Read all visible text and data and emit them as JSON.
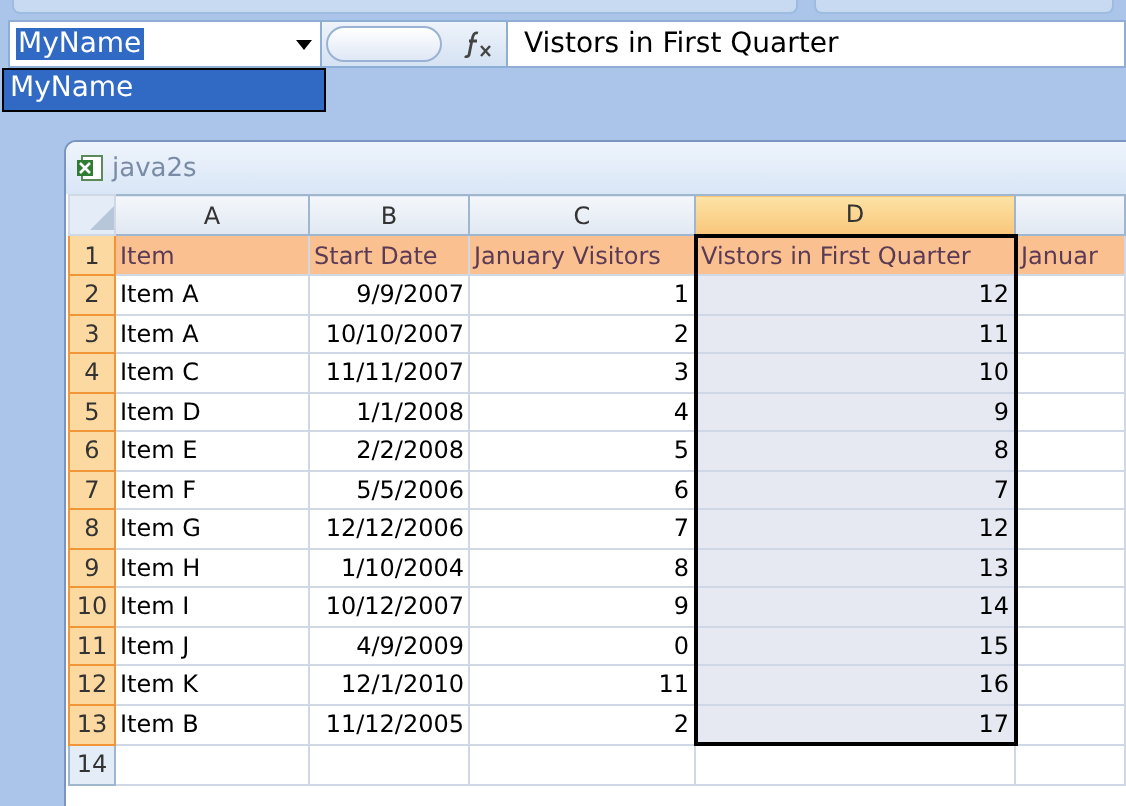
{
  "name_box": {
    "value": "MyName",
    "text_selected": true
  },
  "formula_bar": {
    "value": "Vistors in First Quarter"
  },
  "name_dropdown": {
    "items": [
      {
        "label": "MyName",
        "selected": true
      }
    ]
  },
  "workbook": {
    "title": "java2s",
    "columns": [
      {
        "letter": "A",
        "selected": false,
        "numeric": false
      },
      {
        "letter": "B",
        "selected": false,
        "numeric": true
      },
      {
        "letter": "C",
        "selected": false,
        "numeric": true
      },
      {
        "letter": "D",
        "selected": true,
        "numeric": true
      },
      {
        "selected": false
      }
    ],
    "rows": [
      {
        "number": "1",
        "selected": true,
        "kind": "header",
        "cells": [
          "Item",
          "Start Date",
          "January Visitors",
          "Vistors in First Quarter",
          "Januar"
        ]
      },
      {
        "number": "2",
        "selected": true,
        "kind": "data",
        "cells": [
          "Item A",
          "9/9/2007",
          "1",
          "12"
        ]
      },
      {
        "number": "3",
        "selected": true,
        "kind": "data",
        "cells": [
          "Item A",
          "10/10/2007",
          "2",
          "11"
        ]
      },
      {
        "number": "4",
        "selected": true,
        "kind": "data",
        "cells": [
          "Item C",
          "11/11/2007",
          "3",
          "10"
        ]
      },
      {
        "number": "5",
        "selected": true,
        "kind": "data",
        "cells": [
          "Item D",
          "1/1/2008",
          "4",
          "9"
        ]
      },
      {
        "number": "6",
        "selected": true,
        "kind": "data",
        "cells": [
          "Item E",
          "2/2/2008",
          "5",
          "8"
        ]
      },
      {
        "number": "7",
        "selected": true,
        "kind": "data",
        "cells": [
          "Item F",
          "5/5/2006",
          "6",
          "7"
        ]
      },
      {
        "number": "8",
        "selected": true,
        "kind": "data",
        "cells": [
          "Item G",
          "12/12/2006",
          "7",
          "12"
        ]
      },
      {
        "number": "9",
        "selected": true,
        "kind": "data",
        "cells": [
          "Item H",
          "1/10/2004",
          "8",
          "13"
        ]
      },
      {
        "number": "10",
        "selected": true,
        "kind": "data",
        "cells": [
          "Item I",
          "10/12/2007",
          "9",
          "14"
        ]
      },
      {
        "number": "11",
        "selected": true,
        "kind": "data",
        "cells": [
          "Item J",
          "4/9/2009",
          "0",
          "15"
        ]
      },
      {
        "number": "12",
        "selected": true,
        "kind": "data",
        "cells": [
          "Item K",
          "12/1/2010",
          "11",
          "16"
        ]
      },
      {
        "number": "13",
        "selected": true,
        "kind": "data",
        "cells": [
          "Item B",
          "11/12/2005",
          "2",
          "17"
        ]
      },
      {
        "number": "14",
        "selected": false,
        "kind": "data",
        "cells": []
      }
    ]
  }
}
